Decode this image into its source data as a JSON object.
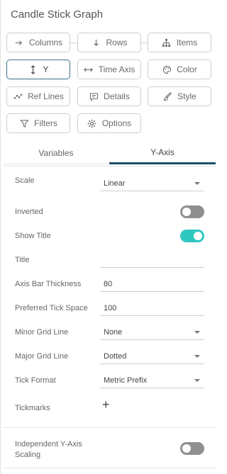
{
  "header": {
    "title": "Candle Stick Graph"
  },
  "buttons": {
    "columns": {
      "label": "Columns",
      "icon": "arrow-right-icon"
    },
    "rows": {
      "label": "Rows",
      "icon": "arrow-down-icon"
    },
    "items": {
      "label": "Items",
      "icon": "hierarchy-icon"
    },
    "y": {
      "label": "Y",
      "icon": "vertical-arrows-icon"
    },
    "time_axis": {
      "label": "Time Axis",
      "icon": "horizontal-arrows-icon"
    },
    "color": {
      "label": "Color",
      "icon": "palette-icon"
    },
    "ref_lines": {
      "label": "Ref Lines",
      "icon": "ref-lines-icon"
    },
    "details": {
      "label": "Details",
      "icon": "speech-bubble-icon"
    },
    "style": {
      "label": "Style",
      "icon": "brush-icon"
    },
    "filters": {
      "label": "Filters",
      "icon": "funnel-icon"
    },
    "options": {
      "label": "Options",
      "icon": "gear-icon"
    }
  },
  "tabs": {
    "variables": "Variables",
    "y_axis": "Y-Axis"
  },
  "settings": {
    "scale": {
      "label": "Scale",
      "value": "Linear"
    },
    "inverted": {
      "label": "Inverted",
      "on": false
    },
    "show_title": {
      "label": "Show Title",
      "on": true
    },
    "title": {
      "label": "Title",
      "value": ""
    },
    "axis_bar_thickness": {
      "label": "Axis Bar Thickness",
      "value": "80"
    },
    "preferred_tick_space": {
      "label": "Preferred Tick Space",
      "value": "100"
    },
    "minor_grid_line": {
      "label": "Minor Grid Line",
      "value": "None"
    },
    "major_grid_line": {
      "label": "Major Grid Line",
      "value": "Dotted"
    },
    "tick_format": {
      "label": "Tick Format",
      "value": "Metric Prefix"
    },
    "tickmarks": {
      "label": "Tickmarks",
      "add_symbol": "+"
    }
  },
  "independent": {
    "label_line1": "Independent Y-Axis",
    "label_line2": "Scaling",
    "on": false
  },
  "colors": {
    "accent": "#2fc7bf",
    "active_border": "#3c6e8a",
    "tab_underline": "#1f4f6b",
    "toggle_off": "#8f8f8f"
  }
}
